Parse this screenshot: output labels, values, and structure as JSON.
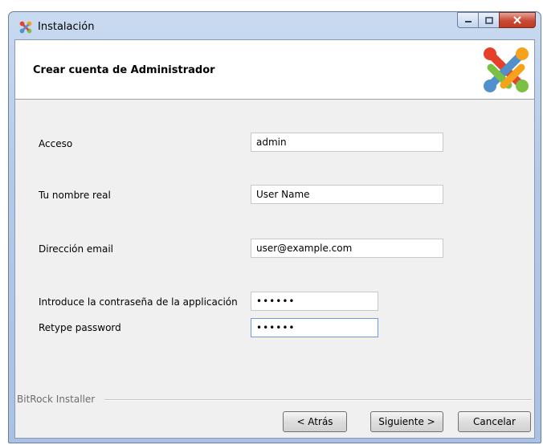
{
  "window": {
    "title": "Instalación"
  },
  "header": {
    "title": "Crear cuenta de Administrador"
  },
  "form": {
    "login_label": "Acceso",
    "login_value": "admin",
    "realname_label": "Tu nombre real",
    "realname_value": "User Name",
    "email_label": "Dirección email",
    "email_value": "user@example.com",
    "password_label": "Introduce la contraseña de la applicación",
    "password_value": "••••••",
    "retype_label": "Retype password",
    "retype_value": "••••••"
  },
  "footer": {
    "brand": "BitRock Installer",
    "back_label": "< Atrás",
    "next_label": "Siguiente >",
    "cancel_label": "Cancelar"
  },
  "icons": {
    "app": "joomla-icon",
    "logo": "joomla-logo",
    "minimize": "minimize-icon",
    "maximize": "maximize-icon",
    "close": "close-icon"
  },
  "colors": {
    "close_button": "#c74a34",
    "focus_border": "#6a9ed6"
  }
}
